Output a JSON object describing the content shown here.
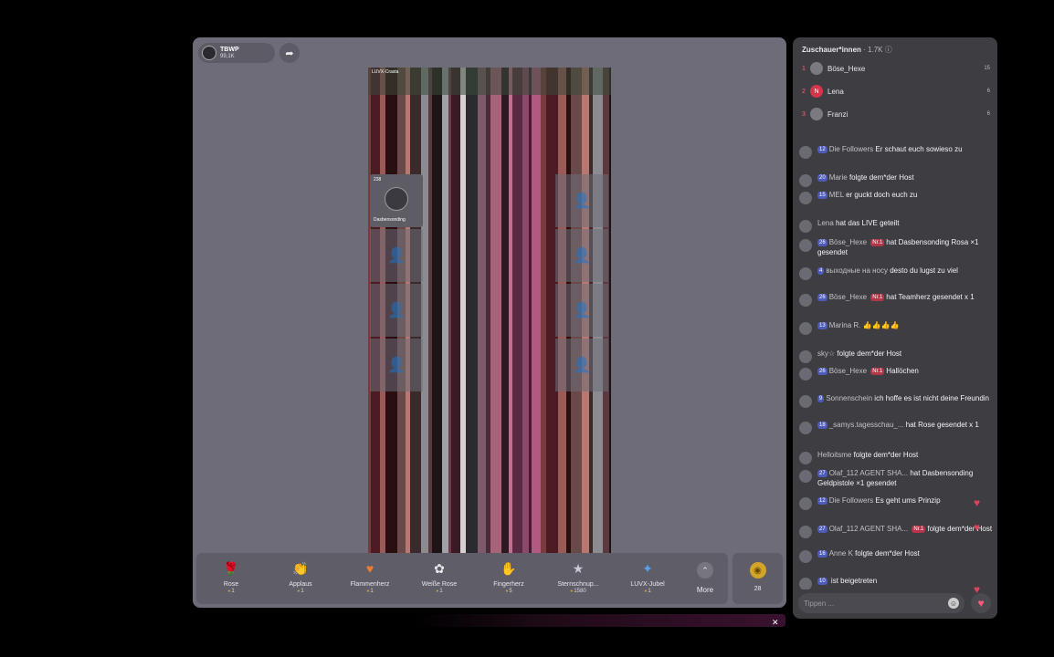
{
  "stream": {
    "host_name": "TBWP",
    "host_likes": "99,1K",
    "video_top_text": "LUVX-Crasta",
    "guest_count": "238",
    "guest_name": "Dasbensonding"
  },
  "gifts": [
    {
      "name": "Rose",
      "price": "1",
      "icon": "rose",
      "color": "#d8344a",
      "glyph": "🌹"
    },
    {
      "name": "Applaus",
      "price": "1",
      "icon": "clapping-hands",
      "color": "#e7b23a",
      "glyph": "👏"
    },
    {
      "name": "Flammenherz",
      "price": "1",
      "icon": "flame-heart",
      "color": "#ef7b2c",
      "glyph": "♥"
    },
    {
      "name": "Weiße Rose",
      "price": "1",
      "icon": "white-rose",
      "color": "#e9e9ea",
      "glyph": "✿"
    },
    {
      "name": "Fingerherz",
      "price": "5",
      "icon": "finger-heart",
      "color": "#e8a17a",
      "glyph": "✋"
    },
    {
      "name": "Sternschnup...",
      "price": "1580",
      "icon": "shooting-star",
      "color": "#c9c9d8",
      "glyph": "★"
    },
    {
      "name": "LUVX-Jubel",
      "price": "1",
      "icon": "luvx-badge",
      "color": "#5aa0e8",
      "glyph": "✦"
    }
  ],
  "more_label": "More",
  "coin_count": "28",
  "panel": {
    "viewers_label": "Zuschauer*innen",
    "viewers_count": "1.7K",
    "top_viewers": [
      {
        "rank": "1",
        "name": "Böse_Hexe",
        "score": "15",
        "initial": ""
      },
      {
        "rank": "2",
        "name": "Lena",
        "score": "6",
        "initial": "N"
      },
      {
        "rank": "3",
        "name": "Franzi",
        "score": "6",
        "initial": ""
      }
    ],
    "messages": [
      {
        "level": "12",
        "user": "Die Followers",
        "text": "Er schaut euch sowieso zu",
        "rank": ""
      },
      {
        "level": "20",
        "user": "Marie",
        "text": "folgte dem*der Host",
        "rank": ""
      },
      {
        "level": "15",
        "user": "MEL",
        "text": "er guckt doch euch zu",
        "rank": ""
      },
      {
        "level": "",
        "user": "Lena",
        "text": "hat das LIVE geteilt",
        "rank": ""
      },
      {
        "level": "26",
        "user": "Böse_Hexe",
        "text": "hat Dasbensonding Rosa ×1 gesendet",
        "rank": "Nr.1"
      },
      {
        "level": "4",
        "user": "выходные на носу",
        "text": "desto du lugst zu viel",
        "rank": ""
      },
      {
        "level": "26",
        "user": "Böse_Hexe",
        "text": "hat Teamherz gesendet x 1",
        "rank": "Nr.1"
      },
      {
        "level": "13",
        "user": "Marina R.",
        "text": "👍👍👍👍",
        "rank": ""
      },
      {
        "level": "",
        "user": "sky☆",
        "text": "folgte dem*der Host",
        "rank": ""
      },
      {
        "level": "26",
        "user": "Böse_Hexe",
        "text": "Hallöchen",
        "rank": "Nr.1"
      },
      {
        "level": "9",
        "user": "Sonnenschein",
        "text": "ich hoffe es ist nicht deine Freundin",
        "rank": ""
      },
      {
        "level": "18",
        "user": "_samys.tagesschau_...",
        "text": "hat Rose gesendet x 1",
        "rank": ""
      },
      {
        "level": "",
        "user": "Helloitsme",
        "text": "folgte dem*der Host",
        "rank": ""
      },
      {
        "level": "27",
        "user": "Olaf_112 AGENT SHA...",
        "text": "hat Dasbensonding Geldpistole ×1 gesendet",
        "rank": ""
      },
      {
        "level": "12",
        "user": "Die Followers",
        "text": "Es geht ums Prinzip",
        "rank": ""
      },
      {
        "level": "27",
        "user": "Olaf_112 AGENT SHA...",
        "text": "folgte dem*der Host",
        "rank": "Nr.1"
      },
      {
        "level": "16",
        "user": "Anne K",
        "text": "folgte dem*der Host",
        "rank": ""
      },
      {
        "level": "10",
        "user": "",
        "text": "ist beigetreten",
        "rank": ""
      }
    ],
    "input_placeholder": "Tippen ..."
  }
}
